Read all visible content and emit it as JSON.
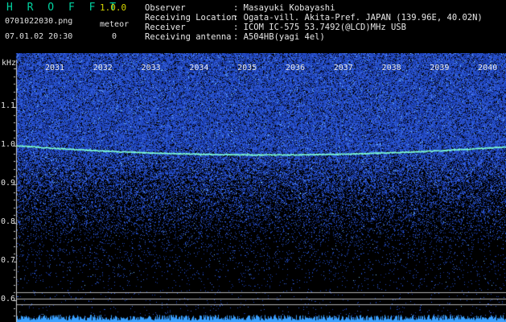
{
  "header": {
    "app_title": "H R O F F T",
    "version": "1.0.0",
    "file_name": "0701022030.png",
    "meteor_label": "meteor",
    "datetime": "07.01.02 20:30",
    "meteor_count": "0"
  },
  "info": [
    {
      "label": "Observer",
      "value": ": Masayuki Kobayashi"
    },
    {
      "label": "Receiving Location",
      "value": ": Ogata-vill. Akita-Pref. JAPAN (139.96E, 40.02N)"
    },
    {
      "label": "Receiver",
      "value": ": ICOM IC-575 53.7492(@LCD)MHz USB"
    },
    {
      "label": "Receiving antenna",
      "value": ": A504HB(yagi 4el)"
    }
  ],
  "colors": {
    "background": "#000000",
    "noise_dense": "#1e3cc8",
    "noise_sparse": "#0a1a8a",
    "signal_trace": "#7fffd4",
    "title": "#00d2a0",
    "version": "#d6d600",
    "reference_lines": "#b0b0b0"
  },
  "chart_data": {
    "type": "heatmap",
    "title": "",
    "ylabel": "kHz",
    "xlabel": "",
    "x_ticks": [
      "2031",
      "2032",
      "2033",
      "2034",
      "2035",
      "2036",
      "2037",
      "2038",
      "2039",
      "2040"
    ],
    "y_ticks": [
      "1.1",
      "1.0",
      "0.9",
      "0.8",
      "0.7",
      "0.6"
    ],
    "y_tick_values": [
      1.1,
      1.0,
      0.9,
      0.8,
      0.7,
      0.6
    ],
    "ylim": [
      0.58,
      1.19
    ],
    "signal_trace": {
      "x": [
        "2030",
        "2035",
        "2040"
      ],
      "y_khz": [
        1.0,
        0.976,
        0.997
      ]
    },
    "reference_lines_khz": [
      0.62,
      0.605,
      0.59
    ]
  }
}
